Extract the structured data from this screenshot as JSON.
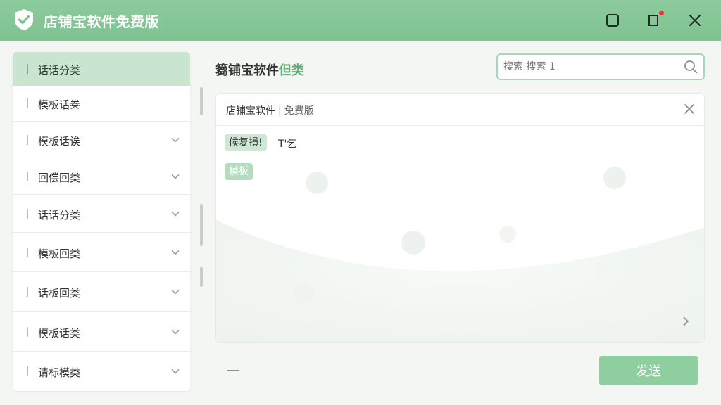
{
  "window": {
    "title": "店铺宝软件免费版"
  },
  "sidebar": {
    "items": [
      {
        "label": "话话分类",
        "active": true,
        "expandable": false
      },
      {
        "label": "模板话桊",
        "active": false,
        "expandable": false
      },
      {
        "label": "模板话诶",
        "active": false,
        "expandable": true
      },
      {
        "label": "回偿回类",
        "active": false,
        "expandable": true
      },
      {
        "label": "话话分类",
        "active": false,
        "expandable": true
      },
      {
        "label": "模板回类",
        "active": false,
        "expandable": true
      },
      {
        "label": "话板回类",
        "active": false,
        "expandable": true
      },
      {
        "label": "模板话类",
        "active": false,
        "expandable": true
      },
      {
        "label": "请标模类",
        "active": false,
        "expandable": true
      }
    ]
  },
  "main": {
    "title_prefix": "篘铺宝软件",
    "title_accent": "但类",
    "search": {
      "placeholder": "搜索 搜索 1"
    },
    "panel": {
      "title": "店铺宝软件",
      "separator": "|",
      "subtitle": "免费版",
      "tag1": "候复損!",
      "tag1_extra": "T'乞",
      "tag2": "模板"
    },
    "send_label": "发送"
  },
  "colors": {
    "accent": "#8fcf9f",
    "titlebar": "#82c496",
    "active_item": "#c9e4cf"
  },
  "icons": {
    "logo": "check-shield-icon",
    "maximize": "square-icon",
    "pin": "pin-notify-icon",
    "close": "close-icon",
    "search": "search-icon",
    "chevron": "chevron-down-icon",
    "next": "chevron-right-icon"
  }
}
